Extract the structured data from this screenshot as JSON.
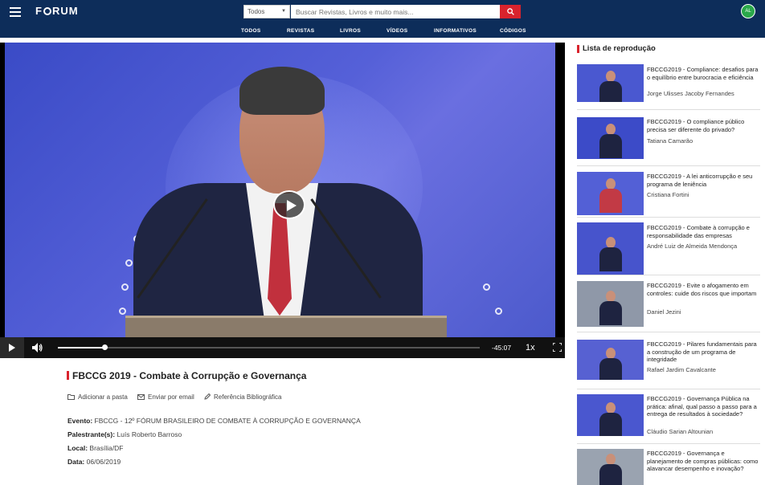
{
  "header": {
    "logo": "FORUM",
    "search_scope": "Todos",
    "search_placeholder": "Buscar Revistas, Livros e muito mais...",
    "nav": [
      "TODOS",
      "REVISTAS",
      "LIVROS",
      "VÍDEOS",
      "INFORMATIVOS",
      "CÓDIGOS"
    ],
    "avatar_initials": "AL",
    "colors": {
      "bar": "#0d2d5a",
      "search_button": "#d9232d",
      "avatar": "#2aa84a"
    }
  },
  "player": {
    "time_remaining": "-45:07",
    "speed": "1x",
    "progress": 0.11
  },
  "video": {
    "title": "FBCCG 2019 - Combate à Corrupção e Governança",
    "actions": [
      "Adicionar a pasta",
      "Enviar por email",
      "Referência Bibliográfica"
    ],
    "meta": [
      {
        "label": "Evento:",
        "value": "FBCCG - 12º FÓRUM BRASILEIRO DE COMBATE À CORRUPÇÃO E GOVERNANÇA"
      },
      {
        "label": "Palestrante(s):",
        "value": "Luís Roberto Barroso"
      },
      {
        "label": "Local:",
        "value": "Brasília/DF"
      },
      {
        "label": "Data:",
        "value": "06/06/2019"
      }
    ]
  },
  "playlist": {
    "heading": "Lista de reprodução",
    "items": [
      {
        "title": "FBCCG2019 - Compliance: desafios para o equilíbrio entre burocracia e eficiência",
        "speaker": "Jorge Ulisses Jacoby Fernandes"
      },
      {
        "title": "FBCCG2019 - O compliance público precisa ser diferente do privado?",
        "speaker": "Tatiana Camarão"
      },
      {
        "title": "FBCCG2019 - A lei anticorrupção e seu programa de leniência",
        "speaker": "Cristiana Fortini"
      },
      {
        "title": "FBCCG2019 - Combate à corrupção e responsabilidade das empresas",
        "speaker": "André Luiz de Almeida Mendonça"
      },
      {
        "title": "FBCCG2019 - Evite o afogamento em controles: cuide dos riscos que importam",
        "speaker": "Daniel Jezini"
      },
      {
        "title": "FBCCG2019 - Pilares fundamentais para a construção de um programa de integridade",
        "speaker": "Rafael Jardim Cavalcante"
      },
      {
        "title": "FBCCG2019 - Governança Pública na prática: afinal, qual passo a passo para a entrega de resultados à sociedade?",
        "speaker": "Cláudio Sarian Altounian"
      },
      {
        "title": "FBCCG2019 - Governança e planejamento de compras públicas: como alavancar desempenho e inovação?",
        "speaker": ""
      }
    ]
  }
}
